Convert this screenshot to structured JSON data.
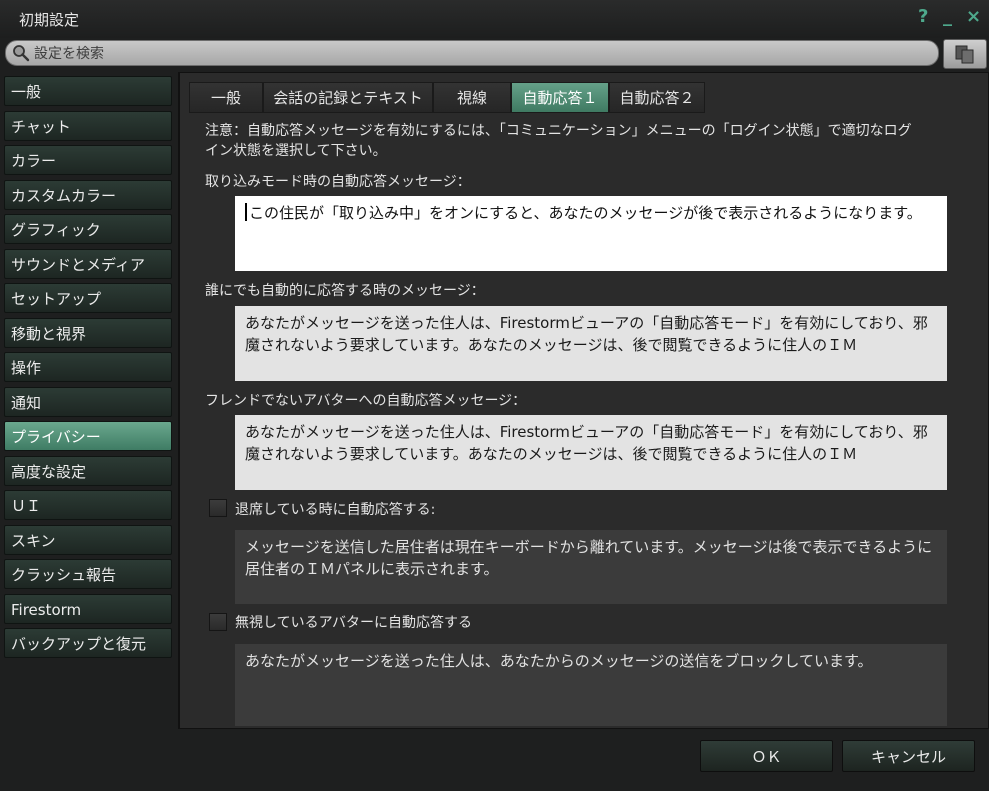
{
  "window": {
    "title": "初期設定",
    "help_icon": "?",
    "minimize_icon": "_",
    "close_icon": "×"
  },
  "search": {
    "placeholder": "設定を検索",
    "value": ""
  },
  "sidebar": {
    "items": [
      {
        "label": "一般"
      },
      {
        "label": "チャット"
      },
      {
        "label": "カラー"
      },
      {
        "label": "カスタムカラー"
      },
      {
        "label": "グラフィック"
      },
      {
        "label": "サウンドとメディア"
      },
      {
        "label": "セットアップ"
      },
      {
        "label": "移動と視界"
      },
      {
        "label": "操作"
      },
      {
        "label": "通知"
      },
      {
        "label": "プライバシー"
      },
      {
        "label": "高度な設定"
      },
      {
        "label": "ＵＩ"
      },
      {
        "label": "スキン"
      },
      {
        "label": "クラッシュ報告"
      },
      {
        "label": "Firestorm"
      },
      {
        "label": "バックアップと復元"
      }
    ],
    "active_index": 10
  },
  "tabs": [
    {
      "label": "一般"
    },
    {
      "label": "会話の記録とテキスト"
    },
    {
      "label": "視線"
    },
    {
      "label": "自動応答１"
    },
    {
      "label": "自動応答２"
    }
  ],
  "active_tab_index": 3,
  "content": {
    "notice": "注意：自動応答メッセージを有効にするには、「コミュニケーション」メニューの「ログイン状態」で適切なログイン状態を選択して下さい。",
    "busy_label": "取り込みモード時の自動応答メッセージ：",
    "busy_message": "この住民が「取り込み中」をオンにすると、あなたのメッセージが後で表示されるようになります。",
    "autorespond_label": "誰にでも自動的に応答する時のメッセージ：",
    "autorespond_message": "あなたがメッセージを送った住人は、Firestormビューアの「自動応答モード」を有効にしており、邪魔されないよう要求しています。あなたのメッセージは、後で閲覧できるように住人のＩＭ",
    "nonfriend_label": "フレンドでないアバターへの自動応答メッセージ：",
    "nonfriend_message": "あなたがメッセージを送った住人は、Firestormビューアの「自動応答モード」を有効にしており、邪魔されないよう要求しています。あなたのメッセージは、後で閲覧できるように住人のＩＭ",
    "away_checkbox_label": "退席している時に自動応答する:",
    "away_checked": false,
    "away_message": "メッセージを送信した居住者は現在キーボードから離れています。メッセージは後で表示できるように居住者のＩＭパネルに表示されます。",
    "muted_checkbox_label": "無視しているアバターに自動応答する",
    "muted_checked": false,
    "muted_message": "あなたがメッセージを送った住人は、あなたからのメッセージの送信をブロックしています。"
  },
  "buttons": {
    "ok": "ＯＫ",
    "cancel": "キャンセル"
  },
  "colors": {
    "accent": "#4ea98c",
    "active_tab": "#5a9780"
  }
}
